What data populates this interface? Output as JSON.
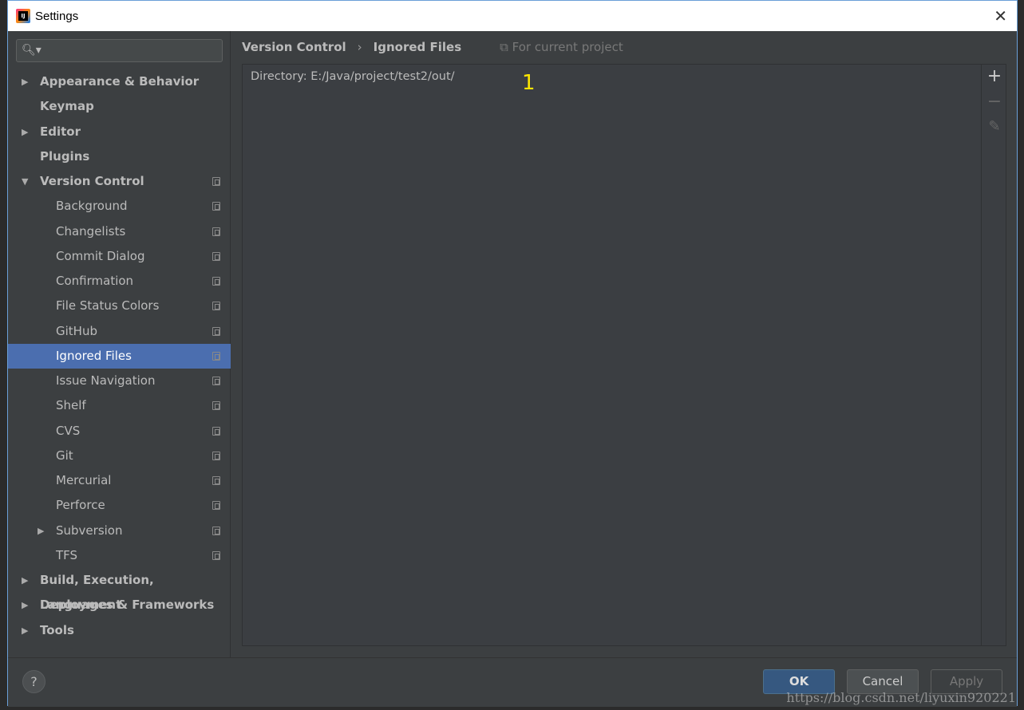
{
  "window": {
    "title": "Settings",
    "close_icon": "close-icon"
  },
  "search": {
    "placeholder": ""
  },
  "sidebar": {
    "items": [
      {
        "label": "Appearance & Behavior",
        "level": 0,
        "bold": true,
        "arrow": "collapsed"
      },
      {
        "label": "Keymap",
        "level": 0,
        "bold": true
      },
      {
        "label": "Editor",
        "level": 0,
        "bold": true,
        "arrow": "collapsed"
      },
      {
        "label": "Plugins",
        "level": 0,
        "bold": true
      },
      {
        "label": "Version Control",
        "level": 0,
        "bold": true,
        "arrow": "expanded",
        "project": true
      },
      {
        "label": "Background",
        "level": 1,
        "project": true
      },
      {
        "label": "Changelists",
        "level": 1,
        "project": true
      },
      {
        "label": "Commit Dialog",
        "level": 1,
        "project": true
      },
      {
        "label": "Confirmation",
        "level": 1,
        "project": true
      },
      {
        "label": "File Status Colors",
        "level": 1,
        "project": true
      },
      {
        "label": "GitHub",
        "level": 1,
        "project": true
      },
      {
        "label": "Ignored Files",
        "level": 1,
        "project": true,
        "selected": true
      },
      {
        "label": "Issue Navigation",
        "level": 1,
        "project": true
      },
      {
        "label": "Shelf",
        "level": 1,
        "project": true
      },
      {
        "label": "CVS",
        "level": 1,
        "project": true
      },
      {
        "label": "Git",
        "level": 1,
        "project": true
      },
      {
        "label": "Mercurial",
        "level": 1,
        "project": true
      },
      {
        "label": "Perforce",
        "level": 1,
        "project": true
      },
      {
        "label": "Subversion",
        "level": 1,
        "project": true,
        "arrow": "collapsed"
      },
      {
        "label": "TFS",
        "level": 1,
        "project": true
      },
      {
        "label": "Build, Execution, Deployment",
        "level": 0,
        "bold": true,
        "arrow": "collapsed"
      },
      {
        "label": "Languages & Frameworks",
        "level": 0,
        "bold": true,
        "arrow": "collapsed"
      },
      {
        "label": "Tools",
        "level": 0,
        "bold": true,
        "arrow": "collapsed"
      }
    ]
  },
  "main": {
    "breadcrumb": [
      "Version Control",
      "Ignored Files"
    ],
    "scope": "For current project",
    "entries": [
      "Directory: E:/Java/project/test2/out/"
    ],
    "annotation": "1",
    "toolbar": {
      "add": "+",
      "remove": "−"
    }
  },
  "footer": {
    "help": "?",
    "ok": "OK",
    "cancel": "Cancel",
    "apply": "Apply"
  },
  "watermark": "https://blog.csdn.net/liyuxin920221",
  "colors": {
    "selection": "#4b6eaf",
    "annotation": "#ffe600",
    "ok_button": "#365880"
  }
}
